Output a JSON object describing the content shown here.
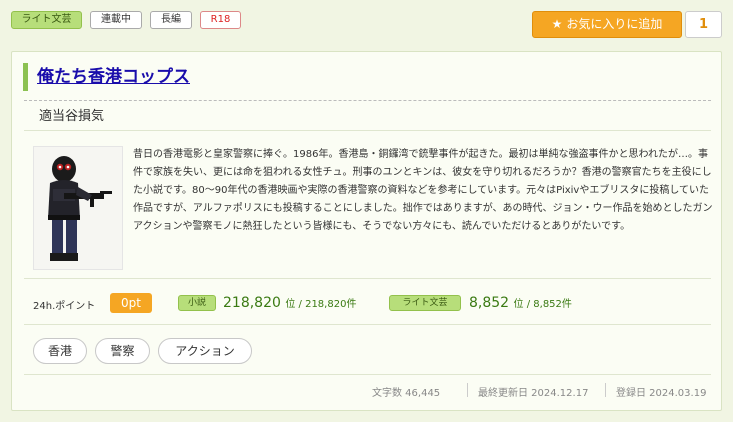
{
  "tags_top": {
    "genre": "ライト文芸",
    "status": "連載中",
    "length": "長編",
    "rating": "R18"
  },
  "favorite": {
    "label": "お気に入りに追加",
    "count": "1",
    "icon": "star-icon"
  },
  "novel": {
    "title": "俺たち香港コップス",
    "author": "適当谷損気",
    "summary": "昔日の香港電影と皇家警察に捧ぐ。1986年。香港島・銅鑼湾で銃撃事件が起きた。最初は単純な強盗事件かと思われたが…。事件で家族を失い、更には命を狙われる女性チュ。刑事のユンとキンは、彼女を守り切れるだろうか？香港の警察官たちを主役にした小説です。80～90年代の香港映画や実際の香港警察の資料などを参考にしています。元々はPixivやエブリスタに投稿していた作品ですが、アルファポリスにも投稿することにしました。拙作ではありますが、あの時代、ジョン・ウー作品を始めとしたガンアクションや警察モノに熱狂したという皆様にも、そうでない方々にも、読んでいただけるとありがたいです。"
  },
  "stats": {
    "points_label": "24h.ポイント",
    "points_value": "0pt",
    "novel_cat": "小説",
    "novel_rank": "218,820",
    "novel_rank_suffix": "位 / 218,820件",
    "genre_cat": "ライト文芸",
    "genre_rank": "8,852",
    "genre_rank_suffix": "位 / 8,852件"
  },
  "keyword_tags": [
    "香港",
    "警察",
    "アクション"
  ],
  "footer": {
    "chars": "文字数 46,445",
    "updated": "最終更新日 2024.12.17",
    "registered": "登録日 2024.03.19"
  },
  "colors": {
    "accent_green": "#8cc152",
    "favorite_orange": "#f5a623",
    "title_link": "#1a0dab"
  }
}
